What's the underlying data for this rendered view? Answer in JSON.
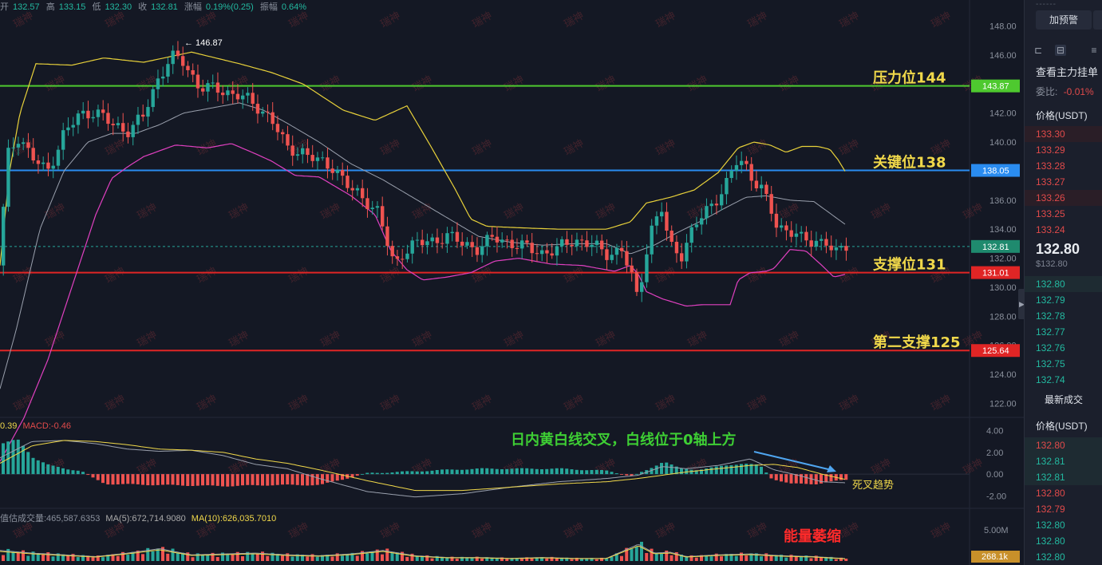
{
  "header": {
    "open_label": "开",
    "open": "132.57",
    "high_label": "高",
    "high": "133.15",
    "low_label": "低",
    "low": "132.30",
    "close_label": "收",
    "close": "132.81",
    "change_label": "涨幅",
    "change": "0.19%(0.25)",
    "amp_label": "振幅",
    "amp": "0.64%"
  },
  "macd_info": {
    "dif": "0.39",
    "macd": "MACD:-0.46"
  },
  "vol_info": {
    "vol": "值估成交量:465,587.6353",
    "ma5": "MA(5):672,714.9080",
    "ma10": "MA(10):626,035.7010"
  },
  "watermark": "瑞神",
  "colors": {
    "up": "#26a69a",
    "down": "#ef5350",
    "yellow": "#f0d84a",
    "white_line": "#9aa0ad",
    "pink": "#e040c0",
    "resistance": "#4ec92f",
    "key": "#2a8cf0",
    "support": "#e02525"
  },
  "chart_data": [
    {
      "type": "candlestick",
      "y_axis_ticks": [
        "148.00",
        "146.00",
        "144.00",
        "142.00",
        "140.00",
        "138.00",
        "136.00",
        "134.00",
        "132.00",
        "130.00",
        "128.00",
        "126.00",
        "124.00",
        "122.00"
      ],
      "ylim": [
        121.2,
        148.8
      ],
      "high_marker": "146.87",
      "current_price": 132.81,
      "horizontal_levels": [
        {
          "price": 143.87,
          "tag": "143.87",
          "label": "压力位144",
          "color": "#4ec92f"
        },
        {
          "price": 138.05,
          "tag": "138.05",
          "label": "关键位138",
          "color": "#2a8cf0"
        },
        {
          "price": 131.01,
          "tag": "131.01",
          "label": "支撑位131",
          "color": "#e02525"
        },
        {
          "price": 125.64,
          "tag": "125.64",
          "label": "第二支撑125",
          "color": "#e02525"
        }
      ],
      "current_tag": "132.81",
      "bollinger_anchor_points": {
        "upper": [
          [
            0,
            131.5
          ],
          [
            12,
            138
          ],
          [
            25,
            142
          ],
          [
            45,
            145.4
          ],
          [
            90,
            145.3
          ],
          [
            130,
            145.8
          ],
          [
            180,
            145.5
          ],
          [
            240,
            146.2
          ],
          [
            300,
            145.4
          ],
          [
            340,
            144.8
          ],
          [
            380,
            144
          ],
          [
            430,
            142.2
          ],
          [
            470,
            141.5
          ],
          [
            510,
            142.5
          ],
          [
            540,
            139.7
          ],
          [
            570,
            136.8
          ],
          [
            590,
            134.7
          ],
          [
            610,
            134.2
          ],
          [
            650,
            134.1
          ],
          [
            700,
            134
          ],
          [
            760,
            134
          ],
          [
            790,
            134.5
          ],
          [
            810,
            135.8
          ],
          [
            840,
            136.2
          ],
          [
            870,
            136.7
          ],
          [
            900,
            137.9
          ],
          [
            925,
            139.6
          ],
          [
            945,
            140.0
          ],
          [
            965,
            139.8
          ],
          [
            985,
            139.3
          ],
          [
            1005,
            139.7
          ],
          [
            1025,
            139.7
          ],
          [
            1040,
            139.5
          ],
          [
            1050,
            138.8
          ],
          [
            1060,
            137.9
          ]
        ],
        "middle": [
          [
            0,
            123
          ],
          [
            20,
            127
          ],
          [
            50,
            134
          ],
          [
            80,
            138
          ],
          [
            110,
            140
          ],
          [
            140,
            140.6
          ],
          [
            170,
            140.6
          ],
          [
            200,
            141.2
          ],
          [
            230,
            142.0
          ],
          [
            260,
            142.3
          ],
          [
            300,
            142.7
          ],
          [
            330,
            142.2
          ],
          [
            360,
            141.3
          ],
          [
            400,
            140.0
          ],
          [
            440,
            138.5
          ],
          [
            480,
            137.4
          ],
          [
            520,
            136.1
          ],
          [
            560,
            134.8
          ],
          [
            600,
            133.5
          ],
          [
            640,
            133.1
          ],
          [
            680,
            132.9
          ],
          [
            720,
            133.0
          ],
          [
            760,
            133.0
          ],
          [
            790,
            132.3
          ],
          [
            820,
            132.9
          ],
          [
            850,
            133.8
          ],
          [
            880,
            134.6
          ],
          [
            910,
            135.5
          ],
          [
            935,
            136.2
          ],
          [
            960,
            136.3
          ],
          [
            990,
            136.0
          ],
          [
            1020,
            135.9
          ],
          [
            1045,
            134.9
          ],
          [
            1060,
            134.3
          ]
        ],
        "lower": [
          [
            0,
            118
          ],
          [
            30,
            121
          ],
          [
            60,
            125
          ],
          [
            90,
            130
          ],
          [
            120,
            135
          ],
          [
            140,
            137.5
          ],
          [
            160,
            138.3
          ],
          [
            180,
            139.0
          ],
          [
            220,
            139.8
          ],
          [
            260,
            139.6
          ],
          [
            290,
            139.9
          ],
          [
            320,
            139.2
          ],
          [
            340,
            138.7
          ],
          [
            370,
            137.7
          ],
          [
            400,
            137.6
          ],
          [
            440,
            136.3
          ],
          [
            470,
            135.0
          ],
          [
            490,
            132.5
          ],
          [
            510,
            131.2
          ],
          [
            530,
            130.5
          ],
          [
            560,
            130.7
          ],
          [
            590,
            131.0
          ],
          [
            620,
            131.8
          ],
          [
            650,
            132.0
          ],
          [
            690,
            131.6
          ],
          [
            730,
            131.5
          ],
          [
            770,
            131.1
          ],
          [
            790,
            131.5
          ],
          [
            800,
            130.9
          ],
          [
            810,
            129.7
          ],
          [
            830,
            129.2
          ],
          [
            860,
            128.7
          ],
          [
            880,
            128.8
          ],
          [
            915,
            128.8
          ],
          [
            925,
            130.5
          ],
          [
            940,
            131.0
          ],
          [
            960,
            131.1
          ],
          [
            970,
            131.3
          ],
          [
            990,
            132.6
          ],
          [
            1010,
            132.5
          ],
          [
            1030,
            131.5
          ],
          [
            1045,
            130.7
          ],
          [
            1060,
            130.9
          ]
        ]
      },
      "candle_anchor_points": [
        [
          0,
          131.5
        ],
        [
          10,
          139
        ],
        [
          25,
          140.5
        ],
        [
          40,
          139
        ],
        [
          60,
          137.9
        ],
        [
          80,
          140.5
        ],
        [
          100,
          141.8
        ],
        [
          120,
          142.2
        ],
        [
          140,
          141.2
        ],
        [
          160,
          140.8
        ],
        [
          180,
          141.7
        ],
        [
          200,
          144.5
        ],
        [
          215,
          145.9
        ],
        [
          230,
          145.5
        ],
        [
          250,
          143.9
        ],
        [
          270,
          143.6
        ],
        [
          300,
          143.3
        ],
        [
          320,
          142.5
        ],
        [
          340,
          141.8
        ],
        [
          360,
          139.5
        ],
        [
          380,
          139.4
        ],
        [
          400,
          138.6
        ],
        [
          420,
          138.3
        ],
        [
          440,
          136.7
        ],
        [
          460,
          136.0
        ],
        [
          475,
          135.2
        ],
        [
          485,
          133.2
        ],
        [
          495,
          131.4
        ],
        [
          505,
          132.4
        ],
        [
          520,
          133.0
        ],
        [
          540,
          133.1
        ],
        [
          560,
          133.6
        ],
        [
          580,
          133.0
        ],
        [
          600,
          132.7
        ],
        [
          620,
          133.4
        ],
        [
          640,
          133.1
        ],
        [
          660,
          132.7
        ],
        [
          680,
          132.4
        ],
        [
          700,
          132.6
        ],
        [
          720,
          133.3
        ],
        [
          740,
          133.0
        ],
        [
          760,
          132.3
        ],
        [
          780,
          132.6
        ],
        [
          792,
          130.8
        ],
        [
          800,
          129.1
        ],
        [
          815,
          133.8
        ],
        [
          830,
          135.4
        ],
        [
          840,
          132.8
        ],
        [
          855,
          132.3
        ],
        [
          870,
          134.1
        ],
        [
          890,
          135.5
        ],
        [
          910,
          137.0
        ],
        [
          925,
          138.7
        ],
        [
          935,
          138.4
        ],
        [
          945,
          137.5
        ],
        [
          955,
          136.8
        ],
        [
          965,
          135.6
        ],
        [
          975,
          134.0
        ],
        [
          990,
          134.1
        ],
        [
          1005,
          133.3
        ],
        [
          1020,
          133.0
        ],
        [
          1035,
          133.4
        ],
        [
          1048,
          132.2
        ],
        [
          1060,
          132.81
        ]
      ]
    },
    {
      "type": "macd",
      "y_axis_ticks": [
        "4.00",
        "2.00",
        "0.00",
        "-2.00"
      ],
      "ylim": [
        -3,
        5
      ],
      "annotation": "日内黄白线交叉，白线位于0轴上方",
      "annotation_2": "死叉趋势",
      "histogram_anchor_points": [
        [
          0,
          2.8
        ],
        [
          20,
          3.2
        ],
        [
          40,
          1.5
        ],
        [
          60,
          0.8
        ],
        [
          80,
          0.5
        ],
        [
          100,
          0.3
        ],
        [
          110,
          -0.2
        ],
        [
          130,
          -0.9
        ],
        [
          200,
          -1.0
        ],
        [
          280,
          -1.1
        ],
        [
          340,
          -1.0
        ],
        [
          400,
          -1.0
        ],
        [
          420,
          -0.6
        ],
        [
          460,
          0.1
        ],
        [
          500,
          0.2
        ],
        [
          560,
          0.4
        ],
        [
          600,
          0.5
        ],
        [
          650,
          0.5
        ],
        [
          700,
          0.5
        ],
        [
          760,
          0.3
        ],
        [
          790,
          -0.2
        ],
        [
          810,
          0.4
        ],
        [
          830,
          1.2
        ],
        [
          850,
          0.5
        ],
        [
          870,
          0.4
        ],
        [
          900,
          0.7
        ],
        [
          930,
          1.0
        ],
        [
          950,
          0.8
        ],
        [
          965,
          -0.4
        ],
        [
          990,
          -0.9
        ],
        [
          1020,
          -0.9
        ],
        [
          1060,
          -0.5
        ]
      ],
      "dif_anchor_points": [
        [
          0,
          1.5
        ],
        [
          40,
          3.0
        ],
        [
          80,
          3.1
        ],
        [
          120,
          2.8
        ],
        [
          160,
          2.3
        ],
        [
          200,
          2.1
        ],
        [
          240,
          2.2
        ],
        [
          280,
          1.7
        ],
        [
          320,
          0.9
        ],
        [
          360,
          0.5
        ],
        [
          400,
          -0.4
        ],
        [
          460,
          -1.6
        ],
        [
          520,
          -2.1
        ],
        [
          580,
          -1.8
        ],
        [
          640,
          -1.2
        ],
        [
          700,
          -0.7
        ],
        [
          760,
          -0.4
        ],
        [
          800,
          -0.1
        ],
        [
          830,
          0.7
        ],
        [
          860,
          0.5
        ],
        [
          900,
          0.8
        ],
        [
          940,
          1.4
        ],
        [
          970,
          0.4
        ],
        [
          1000,
          -0.1
        ],
        [
          1030,
          -0.7
        ],
        [
          1060,
          -0.8
        ]
      ],
      "dea_anchor_points": [
        [
          0,
          1.0
        ],
        [
          40,
          2.6
        ],
        [
          80,
          3.1
        ],
        [
          120,
          3.0
        ],
        [
          160,
          2.7
        ],
        [
          200,
          2.3
        ],
        [
          240,
          2.2
        ],
        [
          280,
          2.0
        ],
        [
          320,
          1.4
        ],
        [
          360,
          1.0
        ],
        [
          400,
          0.4
        ],
        [
          460,
          -0.6
        ],
        [
          520,
          -1.5
        ],
        [
          580,
          -1.5
        ],
        [
          640,
          -1.2
        ],
        [
          700,
          -0.9
        ],
        [
          760,
          -0.7
        ],
        [
          800,
          -0.4
        ],
        [
          830,
          -0.1
        ],
        [
          860,
          0.2
        ],
        [
          900,
          0.5
        ],
        [
          940,
          0.8
        ],
        [
          970,
          0.9
        ],
        [
          1000,
          0.6
        ],
        [
          1030,
          0.0
        ],
        [
          1060,
          -0.5
        ]
      ]
    },
    {
      "type": "volume",
      "y_axis_ticks": [
        "5.00M"
      ],
      "ylim": [
        0,
        6000000
      ],
      "annotation": "能量萎缩",
      "current_tag": "268.1k",
      "volume_anchor_points": [
        [
          0,
          1200000
        ],
        [
          40,
          900000
        ],
        [
          80,
          700000
        ],
        [
          120,
          500000
        ],
        [
          160,
          900000
        ],
        [
          200,
          1400000
        ],
        [
          240,
          700000
        ],
        [
          280,
          800000
        ],
        [
          320,
          900000
        ],
        [
          360,
          700000
        ],
        [
          400,
          600000
        ],
        [
          440,
          800000
        ],
        [
          480,
          1200000
        ],
        [
          520,
          600000
        ],
        [
          560,
          400000
        ],
        [
          600,
          400000
        ],
        [
          640,
          300000
        ],
        [
          680,
          400000
        ],
        [
          720,
          300000
        ],
        [
          760,
          300000
        ],
        [
          790,
          1500000
        ],
        [
          800,
          1900000
        ],
        [
          820,
          900000
        ],
        [
          840,
          1000000
        ],
        [
          860,
          500000
        ],
        [
          900,
          700000
        ],
        [
          940,
          800000
        ],
        [
          980,
          600000
        ],
        [
          1020,
          500000
        ],
        [
          1060,
          268100
        ]
      ]
    }
  ],
  "sidebar": {
    "alert_btn": "加预警",
    "orderbook_title": "查看主力挂单",
    "ratio_label": "委比:",
    "ratio_value": "-0.01%",
    "price_header": "价格(USDT)",
    "asks": [
      "133.30",
      "133.29",
      "133.28",
      "133.27",
      "133.26",
      "133.25",
      "133.24"
    ],
    "last_price": "132.80",
    "last_price_usd": "$132.80",
    "bids": [
      "132.80",
      "132.79",
      "132.78",
      "132.77",
      "132.76",
      "132.75",
      "132.74"
    ],
    "trades_title": "最新成交",
    "trades_header": "价格(USDT)",
    "trades": [
      {
        "p": "132.80",
        "c": "red"
      },
      {
        "p": "132.81",
        "c": "green"
      },
      {
        "p": "132.81",
        "c": "green"
      },
      {
        "p": "132.80",
        "c": "red"
      },
      {
        "p": "132.79",
        "c": "red"
      },
      {
        "p": "132.80",
        "c": "green"
      },
      {
        "p": "132.80",
        "c": "green"
      },
      {
        "p": "132.80",
        "c": "green"
      }
    ]
  }
}
